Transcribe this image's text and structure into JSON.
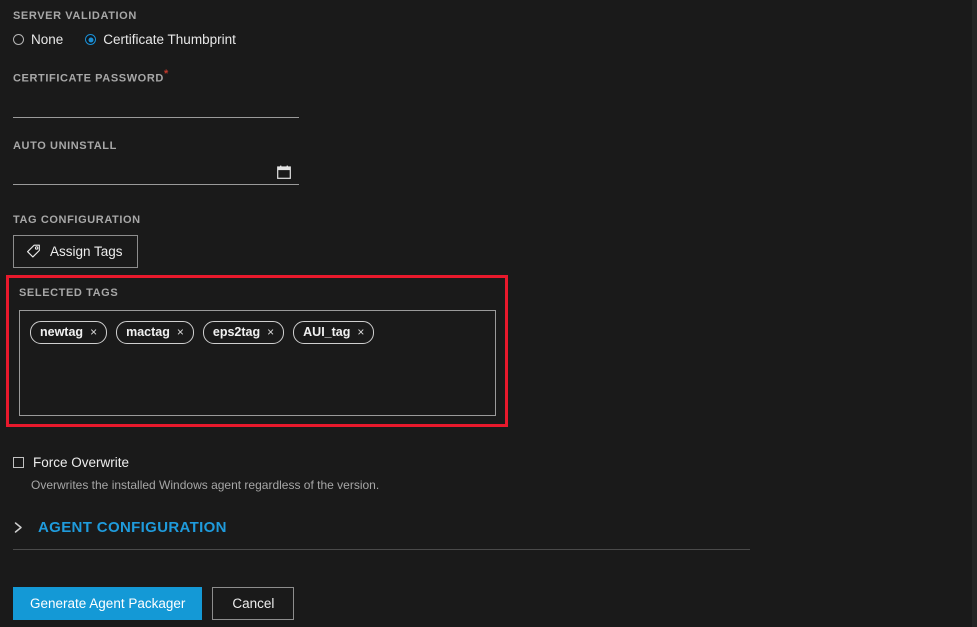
{
  "server_validation": {
    "label": "SERVER VALIDATION",
    "options": [
      {
        "label": "None",
        "selected": false
      },
      {
        "label": "Certificate Thumbprint",
        "selected": true
      }
    ]
  },
  "certificate_password": {
    "label": "CERTIFICATE PASSWORD",
    "required_marker": "*",
    "value": "",
    "placeholder": ""
  },
  "auto_uninstall": {
    "label": "AUTO UNINSTALL",
    "value": "",
    "placeholder": "",
    "icon": "calendar-icon"
  },
  "tag_configuration": {
    "label": "TAG CONFIGURATION",
    "assign_button_label": "Assign Tags",
    "assign_button_icon": "tag-icon"
  },
  "selected_tags": {
    "label": "SELECTED TAGS",
    "highlight_color": "#e8192c",
    "remove_glyph": "×",
    "tags": [
      {
        "name": "newtag"
      },
      {
        "name": "mactag"
      },
      {
        "name": "eps2tag"
      },
      {
        "name": "AUI_tag"
      }
    ]
  },
  "force_overwrite": {
    "label": "Force Overwrite",
    "checked": false,
    "helper_text": "Overwrites the installed Windows agent regardless of the version."
  },
  "agent_configuration": {
    "title": "AGENT CONFIGURATION",
    "expanded": false,
    "chevron_icon": "chevron-right-icon",
    "accent_color": "#1f9bdc"
  },
  "footer": {
    "primary_label": "Generate Agent Packager",
    "primary_color": "#1499d6",
    "secondary_label": "Cancel"
  }
}
